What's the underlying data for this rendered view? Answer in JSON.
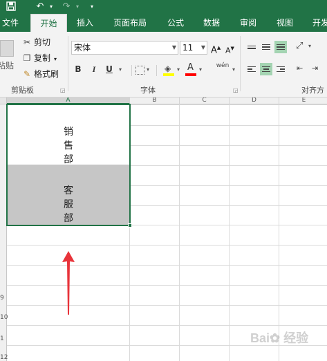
{
  "tabs": [
    "文件",
    "开始",
    "插入",
    "页面布局",
    "公式",
    "数据",
    "审阅",
    "视图",
    "开发"
  ],
  "clipboard": {
    "paste": "粘贴",
    "cut": "剪切",
    "copy": "复制",
    "format_painter": "格式刷",
    "label": "剪贴板"
  },
  "font": {
    "name": "宋体",
    "size": "11",
    "grow": "A",
    "shrink": "A",
    "bold": "B",
    "italic": "I",
    "underline": "U",
    "color_letter": "A",
    "wen": "wén",
    "label": "字体"
  },
  "alignment": {
    "label": "对齐方"
  },
  "columns": [
    "A",
    "B",
    "C",
    "D",
    "E"
  ],
  "rows": [
    "9",
    "10",
    "1",
    "12"
  ],
  "cells": {
    "sales": [
      "销",
      "售",
      "部"
    ],
    "service": [
      "客",
      "服",
      "部"
    ]
  },
  "colors": {
    "accent": "#217346",
    "selection_fill": "#c6c6c6",
    "arrow": "#e8333a",
    "highlight": "#ffff00",
    "font_color": "#ff0000"
  }
}
